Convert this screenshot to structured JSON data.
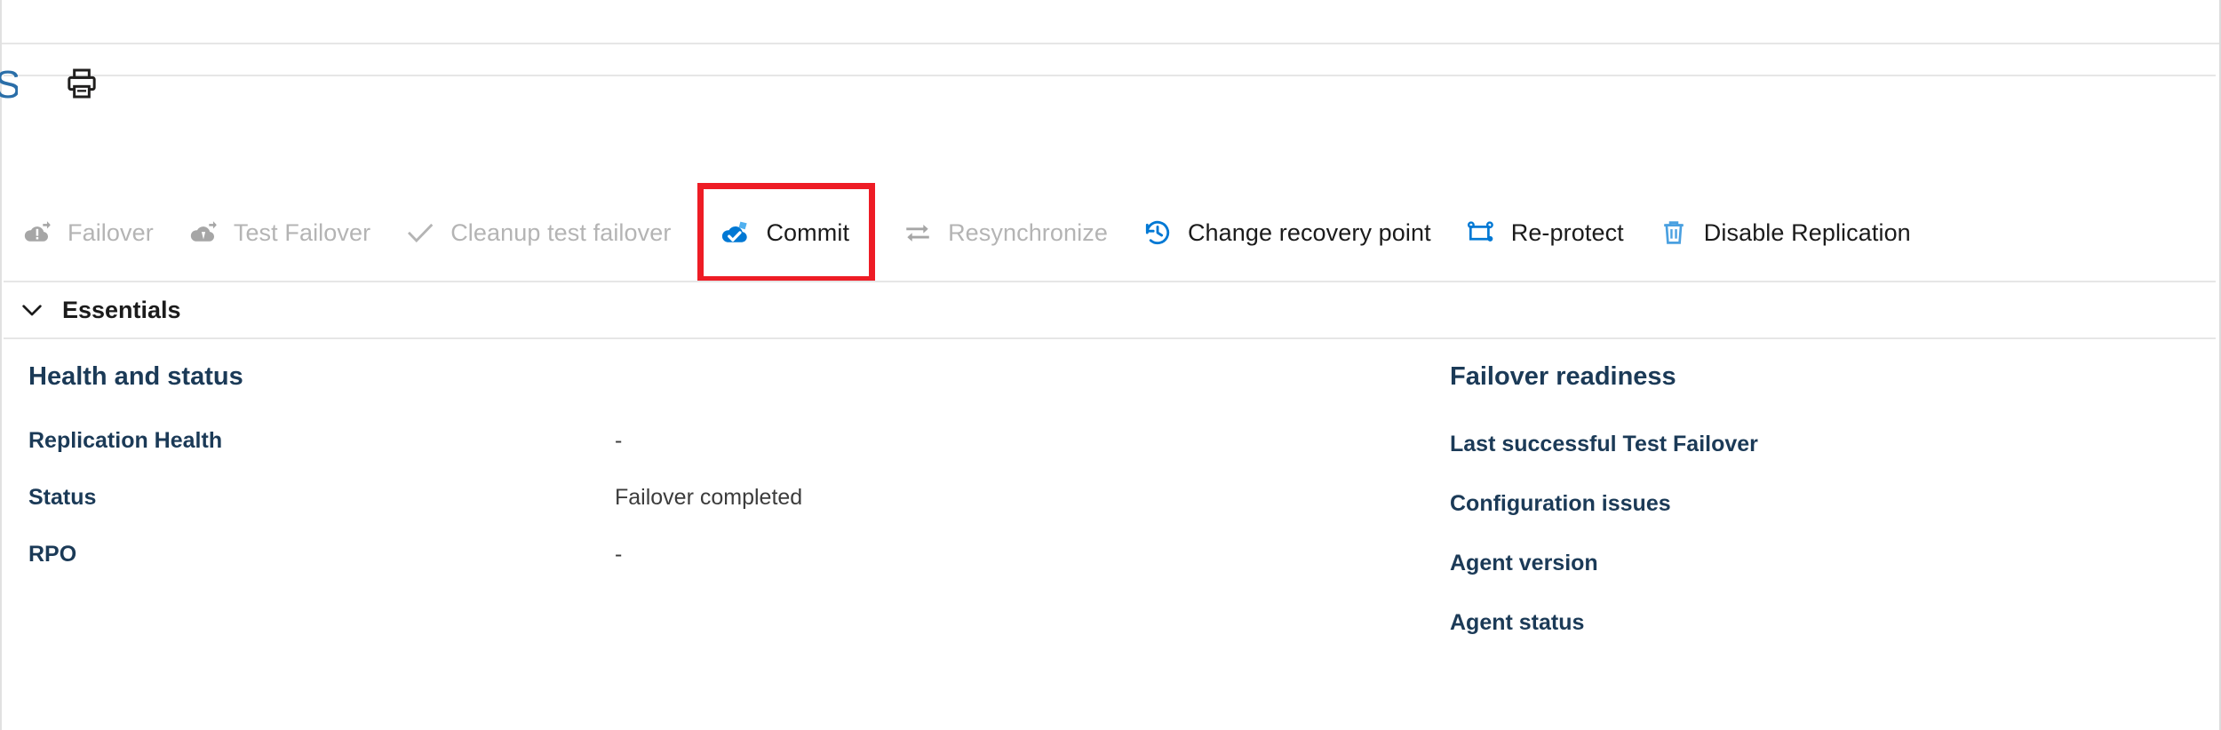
{
  "command_bar": {
    "print_icon": "printer-icon",
    "edge_glyph": "S"
  },
  "toolbar": {
    "items": [
      {
        "label": "Failover",
        "icon": "cloud-failover-icon",
        "enabled": false,
        "highlighted": false
      },
      {
        "label": "Test Failover",
        "icon": "cloud-test-failover-icon",
        "enabled": false,
        "highlighted": false
      },
      {
        "label": "Cleanup test failover",
        "icon": "checkmark-icon",
        "enabled": false,
        "highlighted": false
      },
      {
        "label": "Commit",
        "icon": "cloud-commit-icon",
        "enabled": true,
        "highlighted": true
      },
      {
        "label": "Resynchronize",
        "icon": "sync-arrows-icon",
        "enabled": false,
        "highlighted": false
      },
      {
        "label": "Change recovery point",
        "icon": "clock-rewind-icon",
        "enabled": true,
        "highlighted": false
      },
      {
        "label": "Re-protect",
        "icon": "reprotect-icon",
        "enabled": true,
        "highlighted": false
      },
      {
        "label": "Disable Replication",
        "icon": "trash-icon",
        "enabled": true,
        "highlighted": false
      }
    ],
    "highlight_color": "#ee1c25",
    "accent_color": "#0078d4",
    "disabled_color": "#b4b4b4"
  },
  "essentials": {
    "label": "Essentials",
    "chevron_icon": "chevron-down-icon",
    "expanded": true
  },
  "health_and_status": {
    "title": "Health and status",
    "rows": [
      {
        "key": "Replication Health",
        "value": "-"
      },
      {
        "key": "Status",
        "value": "Failover completed"
      },
      {
        "key": "RPO",
        "value": "-"
      }
    ]
  },
  "failover_readiness": {
    "title": "Failover readiness",
    "rows": [
      {
        "key": "Last successful Test Failover",
        "value": ""
      },
      {
        "key": "Configuration issues",
        "value": ""
      },
      {
        "key": "Agent version",
        "value": ""
      },
      {
        "key": "Agent status",
        "value": ""
      }
    ]
  }
}
